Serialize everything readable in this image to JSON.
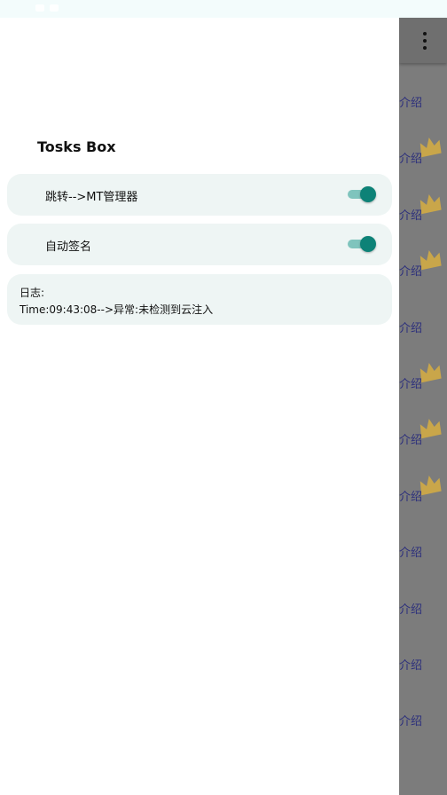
{
  "drawer": {
    "title": "Tosks Box",
    "switches": [
      {
        "label": "跳转-->MT管理器",
        "checked": true
      },
      {
        "label": "自动签名",
        "checked": true
      }
    ],
    "log": {
      "label": "日志:",
      "line": "Time:09:43:08-->异常:未检测到云注入"
    }
  },
  "background_app": {
    "item_label": "介绍",
    "items": [
      {
        "label": "介绍",
        "crown": false
      },
      {
        "label": "介绍",
        "crown": true
      },
      {
        "label": "介绍",
        "crown": true
      },
      {
        "label": "介绍",
        "crown": true
      },
      {
        "label": "介绍",
        "crown": false
      },
      {
        "label": "介绍",
        "crown": true
      },
      {
        "label": "介绍",
        "crown": true
      },
      {
        "label": "介绍",
        "crown": true
      },
      {
        "label": "介绍",
        "crown": false
      },
      {
        "label": "介绍",
        "crown": false
      },
      {
        "label": "介绍",
        "crown": false
      },
      {
        "label": "介绍",
        "crown": false
      }
    ]
  },
  "colors": {
    "accent": "#0d8277",
    "card_background": "#eef5f4",
    "scrim": "#7c7c7c",
    "background_label": "#2c2f7c",
    "crown": "#c9a64a"
  },
  "icons": {
    "menu": "overflow-menu-icon",
    "list_badge": "crown-icon"
  }
}
